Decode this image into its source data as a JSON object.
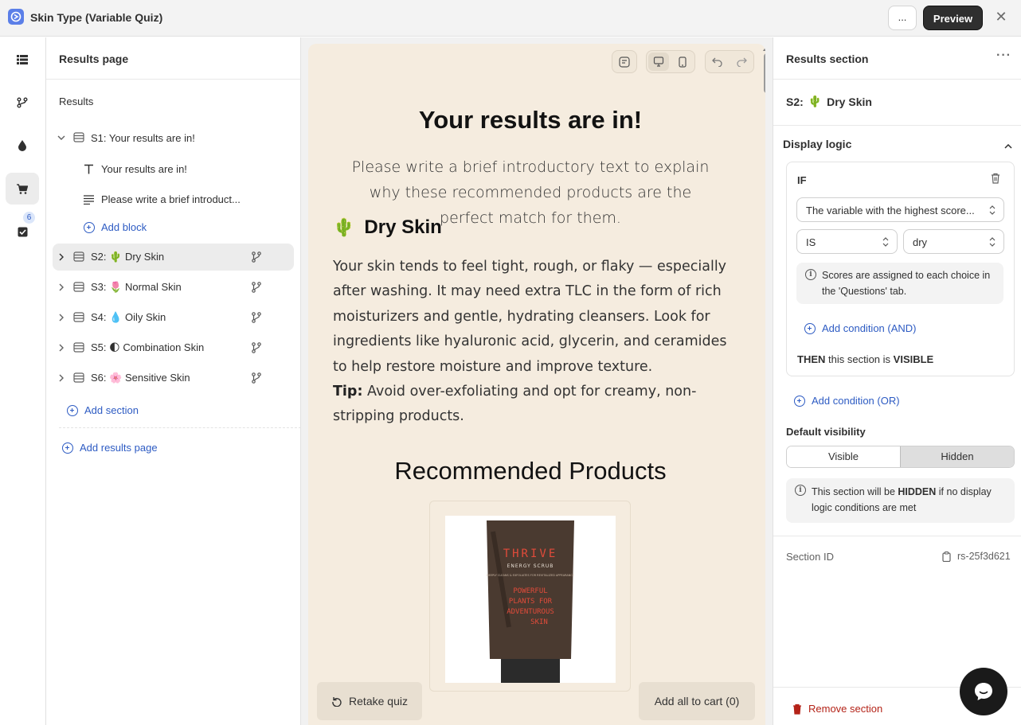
{
  "app": {
    "title": "Skin Type (Variable Quiz)",
    "more_label": "...",
    "preview_label": "Preview"
  },
  "rail": {
    "badge_count": "6"
  },
  "tree": {
    "header": "Results page",
    "group": "Results",
    "s1": {
      "label": "S1: Your results are in!",
      "blocks": [
        "Your results are in!",
        "Please write a brief introduct..."
      ],
      "add_block": "Add block"
    },
    "sections": [
      {
        "prefix": "S2:",
        "emoji": "🌵",
        "name": "Dry Skin"
      },
      {
        "prefix": "S3:",
        "emoji": "🌷",
        "name": "Normal Skin"
      },
      {
        "prefix": "S4:",
        "emoji": "💧",
        "name": "Oily Skin"
      },
      {
        "prefix": "S5:",
        "emoji": "🌓",
        "name": "Combination Skin"
      },
      {
        "prefix": "S6:",
        "emoji": "🌸",
        "name": "Sensitive Skin"
      }
    ],
    "add_section": "Add section",
    "add_results_page": "Add results page"
  },
  "preview": {
    "title": "Your results are in!",
    "intro": "Please write a brief introductory text to explain why these recommended products are the perfect match for them.",
    "section_emoji": "🌵",
    "section_title": "Dry Skin",
    "body": "Your skin tends to feel tight, rough, or flaky — especially after washing. It may need extra TLC in the form of rich moisturizers and gentle, hydrating cleansers. Look for ingredients like hyaluronic acid, glycerin, and ceramides to help restore moisture and improve texture.",
    "tip_label": "Tip:",
    "tip_text": " Avoid over-exfoliating and opt for creamy, non-stripping products.",
    "rec_title": "Recommended Products",
    "product": {
      "brand": "THRIVE",
      "name": "ENERGY SCRUB",
      "tagline": "DEEPLY CLEANS & EXFOLIATES FOR REVITALIZED APPEARANCE",
      "slogan": [
        "POWERFUL",
        "PLANTS FOR",
        "ADVENTUROUS",
        "SKIN"
      ]
    },
    "retake_label": "Retake quiz",
    "add_all_label": "Add all to cart (0)"
  },
  "right": {
    "header": "Results section",
    "subtitle_prefix": "S2:",
    "subtitle_emoji": "🌵",
    "subtitle_name": "Dry Skin",
    "display_logic": "Display logic",
    "if_label": "IF",
    "condition_variable": "The variable with the highest score...",
    "operator": "IS",
    "value": "dry",
    "info": "Scores are assigned to each choice in the 'Questions' tab.",
    "add_and": "Add condition (AND)",
    "then_prefix": "THEN",
    "then_middle": " this section is ",
    "then_state": "VISIBLE",
    "add_or": "Add condition (OR)",
    "default_visibility": "Default visibility",
    "visible_label": "Visible",
    "hidden_label": "Hidden",
    "hidden_info_a": "This section will be ",
    "hidden_info_b": "HIDDEN",
    "hidden_info_c": " if no display logic conditions are met",
    "section_id_label": "Section ID",
    "section_id_value": "rs-25f3d621",
    "remove_label": "Remove section"
  }
}
